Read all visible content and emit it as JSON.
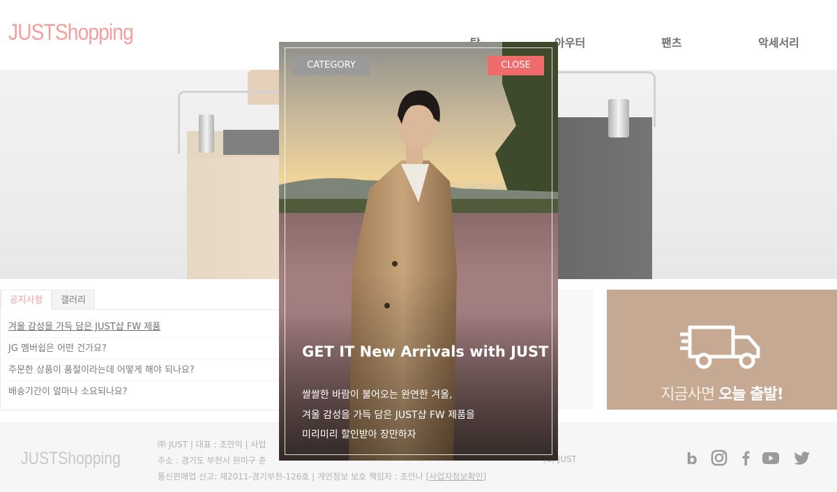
{
  "header": {
    "logo": "JUSTShopping",
    "nav": [
      {
        "label": "탑"
      },
      {
        "label": "아우터"
      },
      {
        "label": "팬츠"
      },
      {
        "label": "악세서리"
      }
    ]
  },
  "notice_board": {
    "tabs": [
      {
        "label": "공지사항"
      },
      {
        "label": "갤러리"
      }
    ],
    "items": [
      {
        "text": "겨울 감성을 가득 담은 JUST샵 FW 제품"
      },
      {
        "text": "JG 멤버쉽은 어떤 건가요?"
      },
      {
        "text": "주문한 상품이 품절이라는데 어떻게 해야 되나요?"
      },
      {
        "text": "배송기간이 얼마나 소요되나요?"
      }
    ]
  },
  "delivery_banner": {
    "text_prefix": "지금사면 ",
    "text_bold": "오늘 출발!"
  },
  "footer": {
    "logo": "JUSTShopping",
    "line1": "㈜ JUST | 대표 : 조안익 | 사업",
    "line2_prefix": "주소 : 경기도 부천시 원미구 춘",
    "line2_suffix": "(C) JUST",
    "line3": "통신판매업 신고: 제2011-경기부천-126호 | 개인정보 보호 책임자 : 조안나 [",
    "line3_link": "사업자정보확인",
    "line3_end": "]",
    "social": [
      {
        "icon": "blog-icon"
      },
      {
        "icon": "instagram-icon"
      },
      {
        "icon": "facebook-icon"
      },
      {
        "icon": "youtube-icon"
      },
      {
        "icon": "twitter-icon"
      }
    ]
  },
  "modal": {
    "category_button": "CATEGORY",
    "close_button": "CLOSE",
    "title": "GET IT New Arrivals with JUST",
    "lines": [
      "쌀쌀한 바람이 불어오는 완연한 겨울,",
      "겨울 감성을 가득 담은 JUST샵 FW 제품을",
      "미리미리 할인받아 장만하자"
    ]
  },
  "colors": {
    "accent": "#f06b6b",
    "delivery_bg": "#a87b5a",
    "footer_bg": "#f1f1f1"
  }
}
